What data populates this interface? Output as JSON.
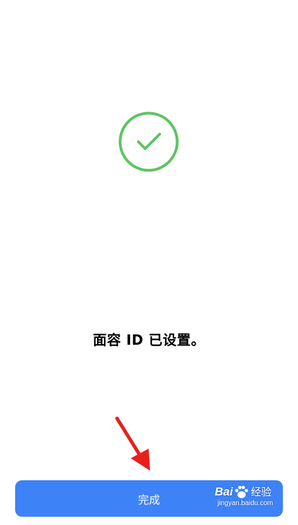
{
  "colors": {
    "background": "#ffffff",
    "check_green": "#5dc462",
    "button_blue": "#3e82f7",
    "arrow_red": "#e8201c"
  },
  "status": {
    "icon": "checkmark-circle-icon",
    "message": "面容 ID 已设置。"
  },
  "actions": {
    "done_label": "完成"
  },
  "watermark": {
    "brand": "Bai",
    "brand_suffix": "经验",
    "url": "jingyan.baidu.com"
  }
}
